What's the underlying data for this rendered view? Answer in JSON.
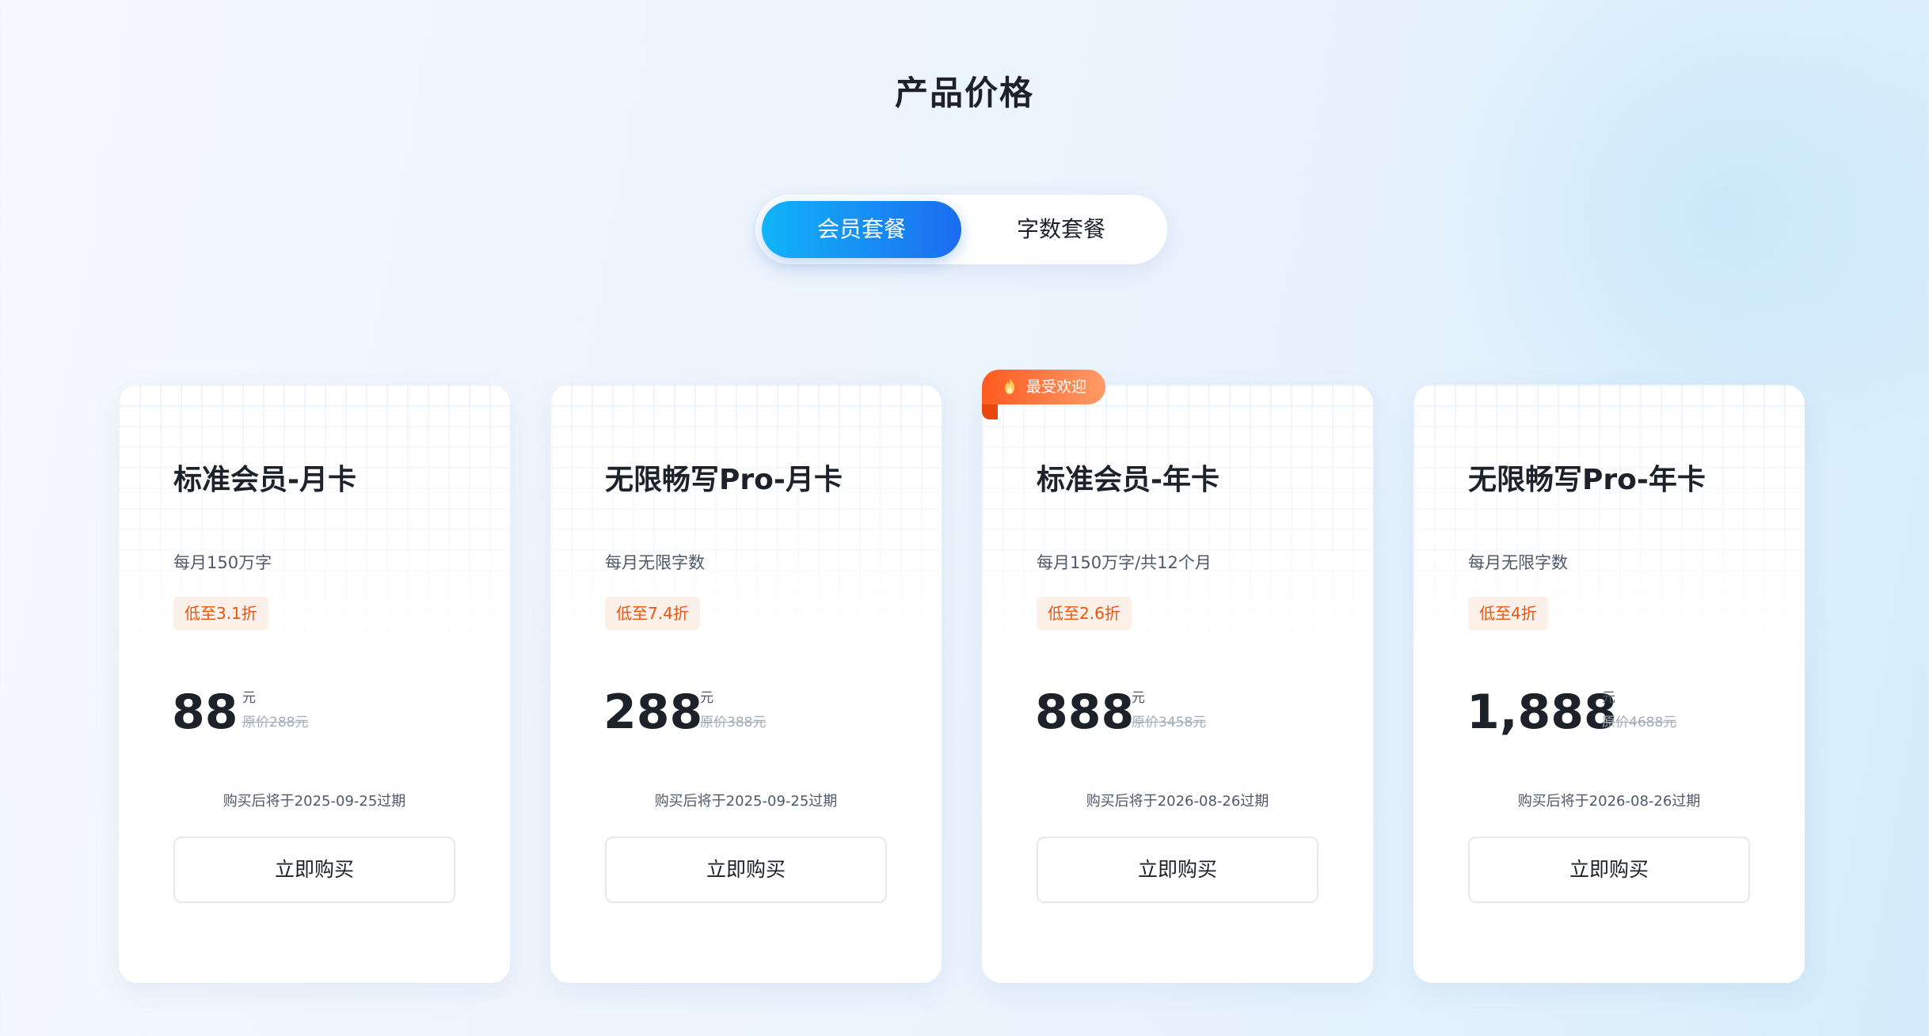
{
  "page": {
    "title": "产品价格"
  },
  "tabs": [
    {
      "label": "会员套餐",
      "active": true
    },
    {
      "label": "字数套餐",
      "active": false
    }
  ],
  "cards": [
    {
      "title": "标准会员-月卡",
      "description": "每月150万字",
      "discount": "低至3.1折",
      "price": "88",
      "unit": "元",
      "original_price": "原价288元",
      "expire": "购买后将于2025-09-25过期",
      "button": "立即购买"
    },
    {
      "title": "无限畅写Pro-月卡",
      "description": "每月无限字数",
      "discount": "低至7.4折",
      "price": "288",
      "unit": "元",
      "original_price": "原价388元",
      "expire": "购买后将于2025-09-25过期",
      "button": "立即购买"
    },
    {
      "title": "标准会员-年卡",
      "description": "每月150万字/共12个月",
      "discount": "低至2.6折",
      "price": "888",
      "unit": "元",
      "original_price": "原价3458元",
      "expire": "购买后将于2026-08-26过期",
      "button": "立即购买",
      "badge": "最受欢迎"
    },
    {
      "title": "无限畅写Pro-年卡",
      "description": "每月无限字数",
      "discount": "低至4折",
      "price": "1,888",
      "unit": "元",
      "original_price": "原价4688元",
      "expire": "购买后将于2026-08-26过期",
      "button": "立即购买"
    }
  ],
  "icons": {
    "badge_icon": "flame-icon"
  },
  "colors": {
    "accent_gradient_start": "#10b4f8",
    "accent_gradient_end": "#1c6cf0",
    "discount_text": "#e8560c",
    "discount_bg": "#fdf0e8",
    "badge_gradient_start": "#ff5a1f",
    "badge_gradient_end": "#ff9b68"
  }
}
